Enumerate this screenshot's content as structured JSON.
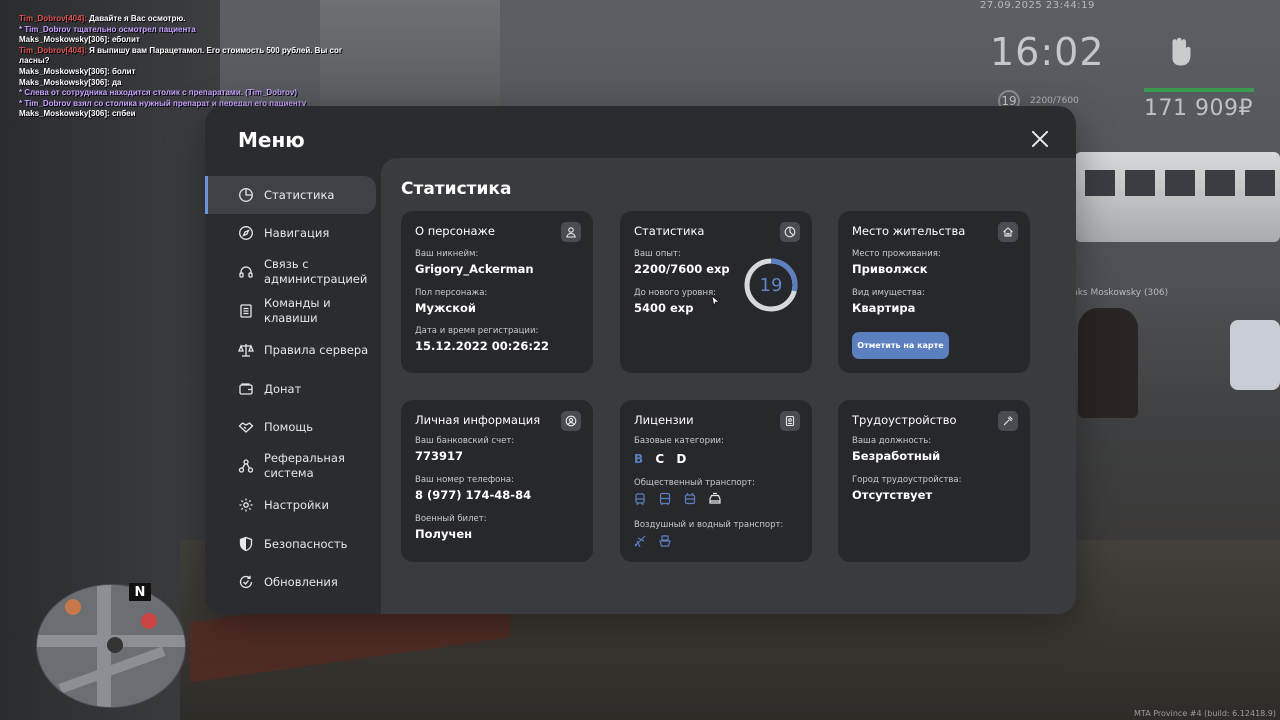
{
  "chat": [
    {
      "color": "red",
      "name": "Tim_Dobrov[404]:",
      "text": " Давайте я Вас осмотрю."
    },
    {
      "color": "purple",
      "name": "",
      "text": "* Tim_Dobrov тщательно осмотрел пациента"
    },
    {
      "color": "white",
      "name": "Maks_Moskowsky[306]:",
      "text": " еболит"
    },
    {
      "color": "red",
      "name": "Tim_Dobrov[404]:",
      "text": " Я выпишу вам Парацетамол. Его стоимость 500 рублей. Вы сог"
    },
    {
      "color": "white",
      "name": "",
      "text": "ласны?"
    },
    {
      "color": "white",
      "name": "Maks_Moskowsky[306]:",
      "text": " болит"
    },
    {
      "color": "white",
      "name": "Maks_Moskowsky[306]:",
      "text": " да"
    },
    {
      "color": "purple",
      "name": "",
      "text": "* Слева от сотрудника находится столик с препаратами. (Tim_Dobrov)"
    },
    {
      "color": "purple",
      "name": "",
      "text": "* Tim_Dobrov взял со столика нужный препарат и передал его пациенту"
    },
    {
      "color": "white",
      "name": "Maks_Moskowsky[306]:",
      "text": " спбеи"
    }
  ],
  "hud": {
    "date": "27.09.2025 23:44:19",
    "time": "16:02",
    "level": "19",
    "exp": "2200/7600",
    "money": "171 909₽",
    "colors": {
      "hp_bar": "#3a9a4f"
    }
  },
  "npc_tag": "nks Moskowsky (306)",
  "minimap": {
    "north": "N"
  },
  "build_info": "MTA Province #4 (build: 6.12418.9)",
  "menu": {
    "title": "Меню",
    "colors": {
      "accent": "#5b7fbf",
      "window": "#2b2c2f",
      "content": "#3a3b3e",
      "card": "#27282b"
    },
    "nav": [
      {
        "label": "Статистика",
        "icon": "pie-chart-icon",
        "active": true
      },
      {
        "label": "Навигация",
        "icon": "compass-icon"
      },
      {
        "label": "Связь с администрацией",
        "icon": "headset-icon"
      },
      {
        "label": "Команды и клавиши",
        "icon": "document-icon"
      },
      {
        "label": "Правила сервера",
        "icon": "scales-icon"
      },
      {
        "label": "Донат",
        "icon": "wallet-icon"
      },
      {
        "label": "Помощь",
        "icon": "handshake-icon"
      },
      {
        "label": "Реферальная система",
        "icon": "network-icon"
      },
      {
        "label": "Настройки",
        "icon": "gear-icon"
      },
      {
        "label": "Безопасность",
        "icon": "shield-icon"
      },
      {
        "label": "Обновления",
        "icon": "refresh-check-icon"
      }
    ],
    "section_title": "Статистика",
    "cards": {
      "character": {
        "title": "О персонаже",
        "icon": "user-icon",
        "nickname_label": "Ваш никнейм:",
        "nickname": "Grigory_Ackerman",
        "gender_label": "Пол персонажа:",
        "gender": "Мужской",
        "reg_label": "Дата и время регистрации:",
        "reg_date": "15.12.2022 00:26:22"
      },
      "stats": {
        "title": "Статистика",
        "icon": "clock-pie-icon",
        "exp_label": "Ваш опыт:",
        "exp": "2200/7600 exp",
        "next_label": "До нового уровня:",
        "next": "5400 exp",
        "level": "19",
        "progress": 0.29
      },
      "residence": {
        "title": "Место жительства",
        "icon": "home-icon",
        "place_label": "Место проживания:",
        "place": "Приволжск",
        "property_label": "Вид имущества:",
        "property": "Квартира",
        "map_button": "Отметить на карте"
      },
      "personal": {
        "title": "Личная информация",
        "icon": "user-circle-icon",
        "bank_label": "Ваш банковский счет:",
        "bank": "773917",
        "phone_label": "Ваш номер телефона:",
        "phone": "8 (977) 174-48-84",
        "military_label": "Военный билет:",
        "military": "Получен"
      },
      "licenses": {
        "title": "Лицензии",
        "icon": "id-card-icon",
        "base_label": "Базовые категории:",
        "categories": [
          "B",
          "C",
          "D"
        ],
        "public_label": "Общественный транспорт:",
        "air_label": "Воздушный и водный транспорт:"
      },
      "job": {
        "title": "Трудоустройство",
        "icon": "hammer-icon",
        "position_label": "Ваша должность:",
        "position": "Безработный",
        "city_label": "Город трудоустройства:",
        "city": "Отсутствует"
      }
    }
  }
}
